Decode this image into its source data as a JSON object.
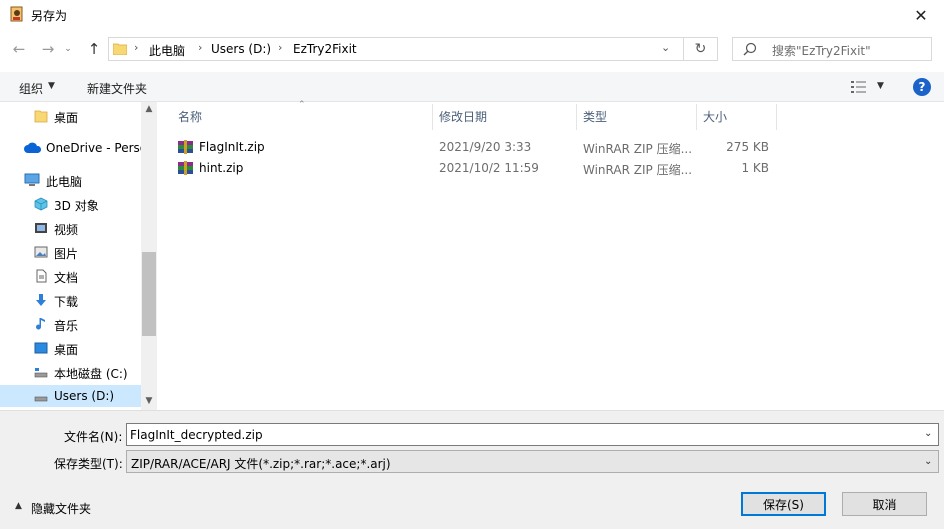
{
  "window": {
    "title": "另存为"
  },
  "address": {
    "crumbs": [
      "此电脑",
      "Users (D:)",
      "EzTry2Fixit"
    ]
  },
  "search": {
    "placeholder": "搜索\"EzTry2Fixit\""
  },
  "toolbar": {
    "organize": "组织",
    "new_folder": "新建文件夹"
  },
  "sidebar": {
    "items": [
      {
        "label": "桌面",
        "icon": "folder-icon"
      },
      {
        "label": "OneDrive - Perso",
        "icon": "cloud-icon"
      },
      {
        "label": "此电脑",
        "icon": "pc-icon"
      },
      {
        "label": "3D 对象",
        "icon": "cube-icon"
      },
      {
        "label": "视频",
        "icon": "video-icon"
      },
      {
        "label": "图片",
        "icon": "picture-icon"
      },
      {
        "label": "文档",
        "icon": "document-icon"
      },
      {
        "label": "下载",
        "icon": "download-icon"
      },
      {
        "label": "音乐",
        "icon": "music-icon"
      },
      {
        "label": "桌面",
        "icon": "desktop-icon"
      },
      {
        "label": "本地磁盘 (C:)",
        "icon": "drive-icon"
      },
      {
        "label": "Users (D:)",
        "icon": "drive-icon"
      }
    ]
  },
  "columns": {
    "name": "名称",
    "date": "修改日期",
    "type": "类型",
    "size": "大小"
  },
  "files": [
    {
      "name": "FlagInIt.zip",
      "date": "2021/9/20 3:33",
      "type": "WinRAR ZIP 压缩...",
      "size": "275 KB"
    },
    {
      "name": "hint.zip",
      "date": "2021/10/2 11:59",
      "type": "WinRAR ZIP 压缩...",
      "size": "1 KB"
    }
  ],
  "form": {
    "filename_label": "文件名(N):",
    "filename_value": "FlagInIt_decrypted.zip",
    "filetype_label": "保存类型(T):",
    "filetype_value": "ZIP/RAR/ACE/ARJ 文件(*.zip;*.rar;*.ace;*.arj)"
  },
  "footer": {
    "hide_folders": "隐藏文件夹",
    "save": "保存(S)",
    "cancel": "取消"
  },
  "colors": {
    "accent": "#0078d7",
    "selected": "#cce8ff",
    "help": "#1b62c9"
  }
}
